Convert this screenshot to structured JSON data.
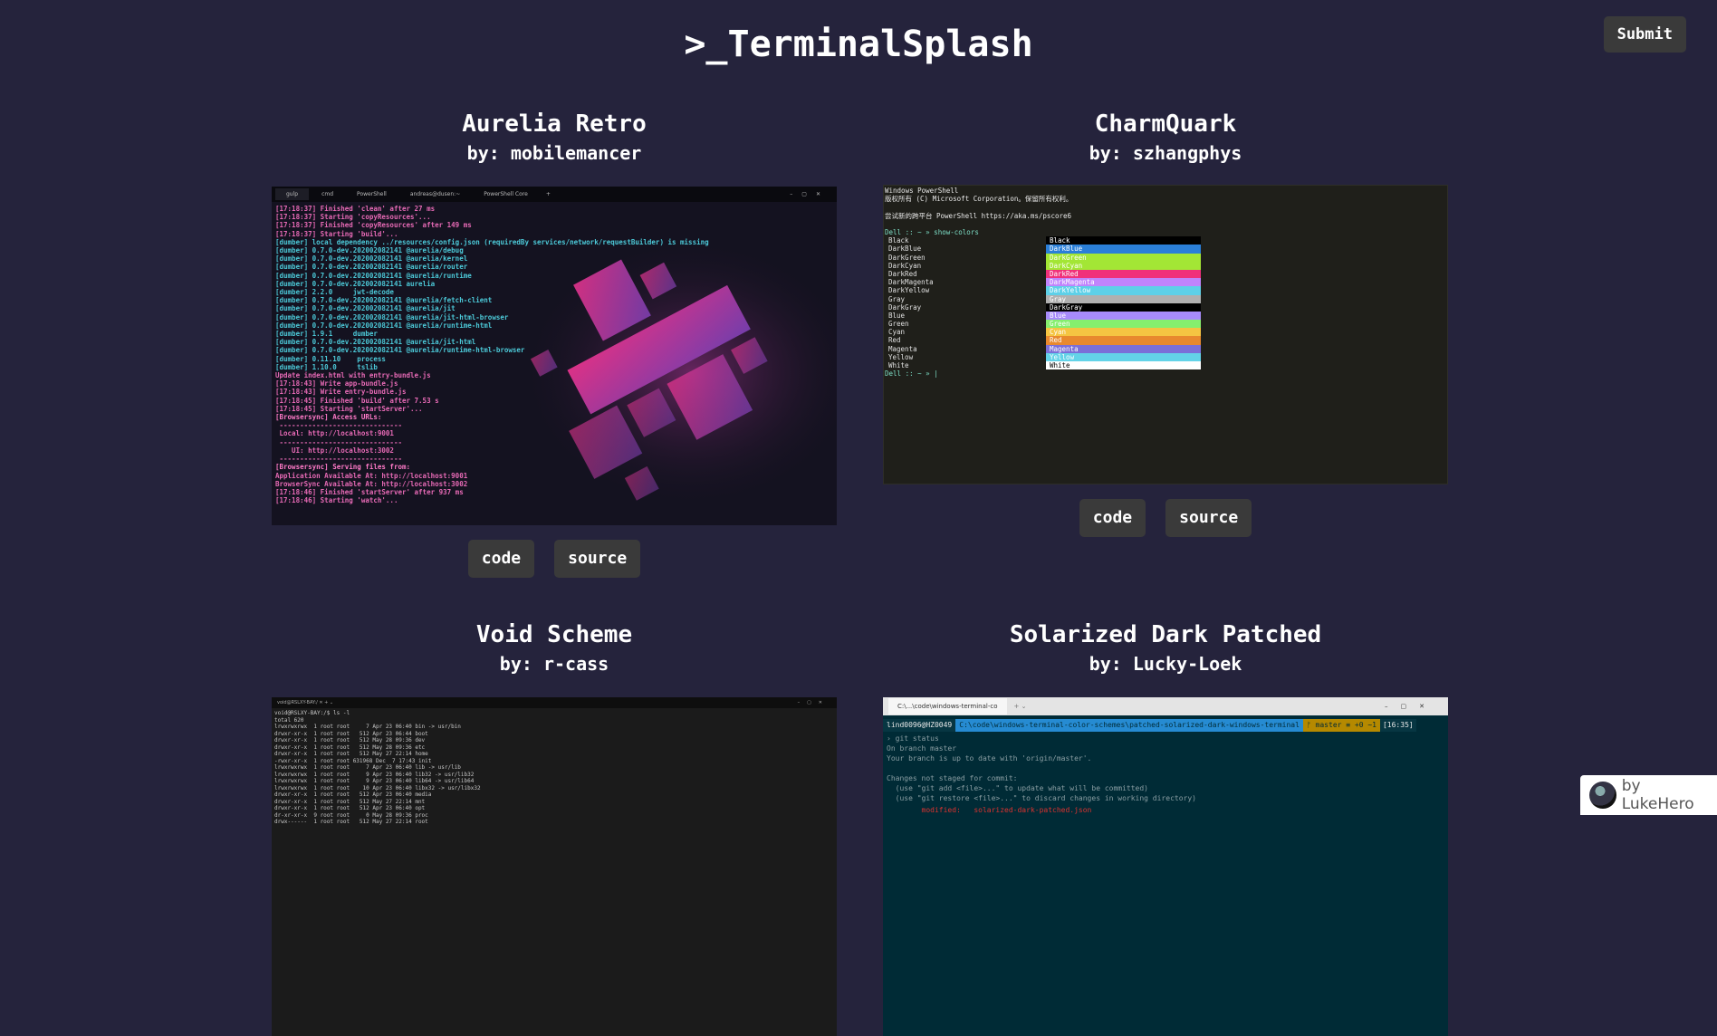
{
  "header": {
    "title": ">_TerminalSplash",
    "submit_label": "Submit"
  },
  "themes": [
    {
      "name": "Aurelia Retro",
      "author": "by: mobilemancer",
      "code_label": "code",
      "source_label": "source",
      "preview": {
        "tabs": [
          "gulp",
          "cmd",
          "PowerShell",
          "andreas@dusen:~",
          "PowerShell Core"
        ],
        "lines": [
          "[17:18:37] Finished 'clean' after 27 ms",
          "[17:18:37] Starting 'copyResources'...",
          "[17:18:37] Finished 'copyResources' after 149 ms",
          "[17:18:37] Starting 'build'...",
          "[dumber] local dependency ../resources/config.json (requiredBy services/network/requestBuilder) is missing",
          "[dumber] 0.7.0-dev.202002082141 @aurelia/debug",
          "[dumber] 0.7.0-dev.202002082141 @aurelia/kernel",
          "[dumber] 0.7.0-dev.202002082141 @aurelia/router",
          "[dumber] 0.7.0-dev.202002082141 @aurelia/runtime",
          "[dumber] 0.7.0-dev.202002082141 aurelia",
          "[dumber] 2.2.0     jwt-decode",
          "[dumber] 0.7.0-dev.202002082141 @aurelia/fetch-client",
          "[dumber] 0.7.0-dev.202002082141 @aurelia/jit",
          "[dumber] 0.7.0-dev.202002082141 @aurelia/jit-html-browser",
          "[dumber] 0.7.0-dev.202002082141 @aurelia/runtime-html",
          "[dumber] 1.9.1     dumber",
          "[dumber] 0.7.0-dev.202002082141 @aurelia/jit-html",
          "[dumber] 0.7.0-dev.202002082141 @aurelia/runtime-html-browser",
          "[dumber] 0.11.10    process",
          "[dumber] 1.10.0     tslib",
          "Update index.html with entry-bundle.js",
          "[17:18:43] Write app-bundle.js",
          "[17:18:43] Write entry-bundle.js",
          "[17:18:45] Finished 'build' after 7.53 s",
          "[17:18:45] Starting 'startServer'...",
          "[Browsersync] Access URLs:",
          " ------------------------------",
          " Local: http://localhost:9001",
          " ------------------------------",
          "    UI: http://localhost:3002",
          " ------------------------------",
          "[Browsersync] Serving files from:",
          "Application Available At: http://localhost:9001",
          "BrowserSync Available At: http://localhost:3002",
          "[17:18:46] Finished 'startServer' after 937 ms",
          "[17:18:46] Starting 'watch'..."
        ]
      }
    },
    {
      "name": "CharmQuark",
      "author": "by: szhangphys",
      "code_label": "code",
      "source_label": "source",
      "preview": {
        "header_lines": [
          "Windows PowerShell",
          "版权所有 (C) Microsoft Corporation。保留所有权利。",
          "",
          "尝试新的跨平台 PowerShell https://aka.ms/pscore6",
          ""
        ],
        "prompt": "Dell :: ~ » show-colors",
        "prompt_end": "Dell :: ~ » |",
        "colors": [
          {
            "name": "Black",
            "swatch": "#000000",
            "fg": "#ffffff"
          },
          {
            "name": "DarkBlue",
            "swatch": "#2b7fd8",
            "fg": "#ffffff"
          },
          {
            "name": "DarkGreen",
            "swatch": "#a3e635",
            "fg": "#ffffff"
          },
          {
            "name": "DarkCyan",
            "swatch": "#a3e635",
            "fg": "#ffffff"
          },
          {
            "name": "DarkRed",
            "swatch": "#f0307a",
            "fg": "#ffffff"
          },
          {
            "name": "DarkMagenta",
            "swatch": "#c084fc",
            "fg": "#ffffff"
          },
          {
            "name": "DarkYellow",
            "swatch": "#5ed0e8",
            "fg": "#ffffff"
          },
          {
            "name": "Gray",
            "swatch": "#b0b0b0",
            "fg": "#ffffff"
          },
          {
            "name": "DarkGray",
            "swatch": "#000000",
            "fg": "#ffffff"
          },
          {
            "name": "Blue",
            "swatch": "#a78bfa",
            "fg": "#ffffff"
          },
          {
            "name": "Green",
            "swatch": "#86ef6e",
            "fg": "#ffffff"
          },
          {
            "name": "Cyan",
            "swatch": "#f5c542",
            "fg": "#ffffff"
          },
          {
            "name": "Red",
            "swatch": "#e8892e",
            "fg": "#ffffff"
          },
          {
            "name": "Magenta",
            "swatch": "#7b6fd8",
            "fg": "#ffffff"
          },
          {
            "name": "Yellow",
            "swatch": "#63d3e8",
            "fg": "#ffffff"
          },
          {
            "name": "White",
            "swatch": "#ffffff",
            "fg": "#000000"
          }
        ]
      }
    },
    {
      "name": "Void Scheme",
      "author": "by: r-cass",
      "preview": {
        "lines": [
          "void@RSLXY-BAY:/$ ls -l",
          "total 620",
          "lrwxrwxrwx  1 root root     7 Apr 23 06:40 bin -> usr/bin",
          "drwxr-xr-x  1 root root   512 Apr 23 06:44 boot",
          "drwxr-xr-x  1 root root   512 May 28 09:36 dev",
          "drwxr-xr-x  1 root root   512 May 28 09:36 etc",
          "drwxr-xr-x  1 root root   512 May 27 22:14 home",
          "-rwxr-xr-x  1 root root 631968 Dec  7 17:43 init",
          "lrwxrwxrwx  1 root root     7 Apr 23 06:40 lib -> usr/lib",
          "lrwxrwxrwx  1 root root     9 Apr 23 06:40 lib32 -> usr/lib32",
          "lrwxrwxrwx  1 root root     9 Apr 23 06:40 lib64 -> usr/lib64",
          "lrwxrwxrwx  1 root root    10 Apr 23 06:40 libx32 -> usr/libx32",
          "drwxr-xr-x  1 root root   512 Apr 23 06:40 media",
          "drwxr-xr-x  1 root root   512 May 27 22:14 mnt",
          "drwxr-xr-x  1 root root   512 Apr 23 06:40 opt",
          "dr-xr-xr-x  9 root root     0 May 28 09:36 proc",
          "drwx------  1 root root   512 May 27 22:14 root"
        ]
      }
    },
    {
      "name": "Solarized Dark Patched",
      "author": "by: Lucky-Loek",
      "preview": {
        "tab": "C:\\...\\code\\windows-terminal-co",
        "prompt_user": "lind0096@HZ0049",
        "prompt_path": "C:\\code\\windows-terminal-color-schemes\\patched-solarized-dark-windows-terminal",
        "prompt_git": "ᚠ master ≡ +0 ~1",
        "prompt_time": "[16:35]",
        "lines": [
          "› git status",
          "On branch master",
          "Your branch is up to date with 'origin/master'.",
          "",
          "Changes not staged for commit:",
          "  (use \"git add <file>...\" to update what will be committed)",
          "  (use \"git restore <file>...\" to discard changes in working directory)"
        ],
        "modified": "        modified:   solarized-dark-patched.json"
      }
    }
  ],
  "credit": {
    "text": "by LukeHero"
  }
}
